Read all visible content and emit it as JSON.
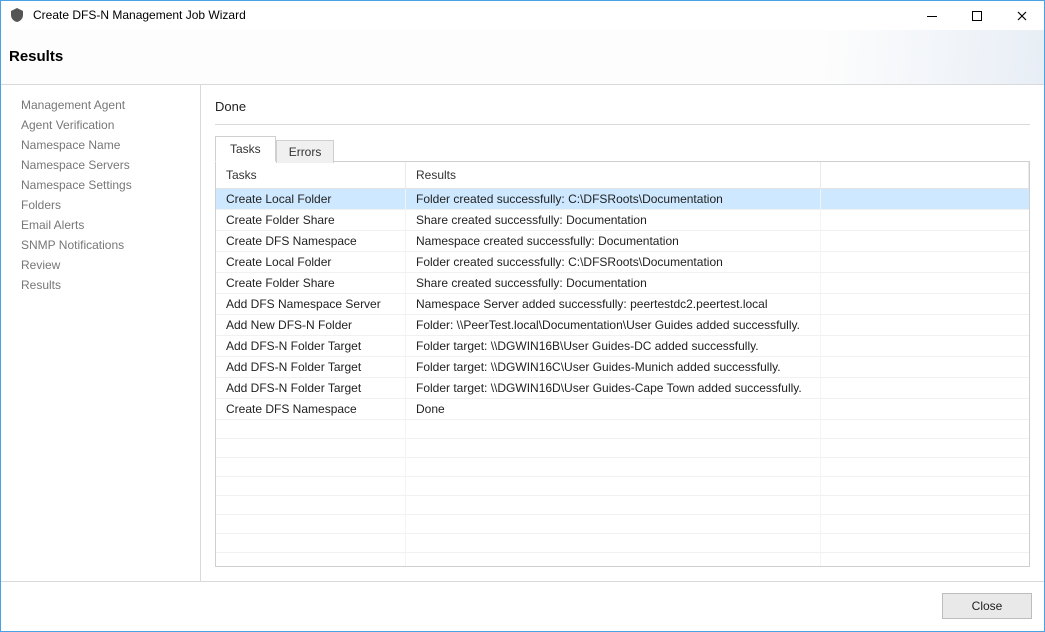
{
  "window": {
    "title": "Create DFS-N Management Job Wizard"
  },
  "header": {
    "title": "Results"
  },
  "sidebar": {
    "items": [
      {
        "label": "Management Agent"
      },
      {
        "label": "Agent Verification"
      },
      {
        "label": "Namespace Name"
      },
      {
        "label": "Namespace Servers"
      },
      {
        "label": "Namespace Settings"
      },
      {
        "label": "Folders"
      },
      {
        "label": "Email Alerts"
      },
      {
        "label": "SNMP Notifications"
      },
      {
        "label": "Review"
      },
      {
        "label": "Results"
      }
    ]
  },
  "main": {
    "section_label": "Done",
    "tabs": [
      {
        "label": "Tasks",
        "active": true
      },
      {
        "label": "Errors",
        "active": false
      }
    ],
    "columns": {
      "tasks": "Tasks",
      "results": "Results"
    },
    "rows": [
      {
        "task": "Create Local Folder",
        "result": "Folder created successfully: C:\\DFSRoots\\Documentation",
        "selected": true
      },
      {
        "task": "Create Folder Share",
        "result": "Share created successfully: Documentation",
        "selected": false
      },
      {
        "task": "Create DFS Namespace",
        "result": "Namespace created successfully: Documentation",
        "selected": false
      },
      {
        "task": "Create Local Folder",
        "result": "Folder created successfully: C:\\DFSRoots\\Documentation",
        "selected": false
      },
      {
        "task": "Create Folder Share",
        "result": "Share created successfully: Documentation",
        "selected": false
      },
      {
        "task": "Add DFS Namespace Server",
        "result": "Namespace Server added successfully: peertestdc2.peertest.local",
        "selected": false
      },
      {
        "task": "Add New DFS-N Folder",
        "result": "Folder: \\\\PeerTest.local\\Documentation\\User Guides added successfully.",
        "selected": false
      },
      {
        "task": "Add DFS-N Folder Target",
        "result": "Folder target: \\\\DGWIN16B\\User Guides-DC added successfully.",
        "selected": false
      },
      {
        "task": "Add DFS-N Folder Target",
        "result": "Folder target: \\\\DGWIN16C\\User Guides-Munich added successfully.",
        "selected": false
      },
      {
        "task": "Add DFS-N Folder Target",
        "result": "Folder target: \\\\DGWIN16D\\User Guides-Cape Town added successfully.",
        "selected": false
      },
      {
        "task": "Create DFS Namespace",
        "result": "Done",
        "selected": false
      }
    ],
    "empty_rows": 9
  },
  "footer": {
    "close_label": "Close"
  }
}
